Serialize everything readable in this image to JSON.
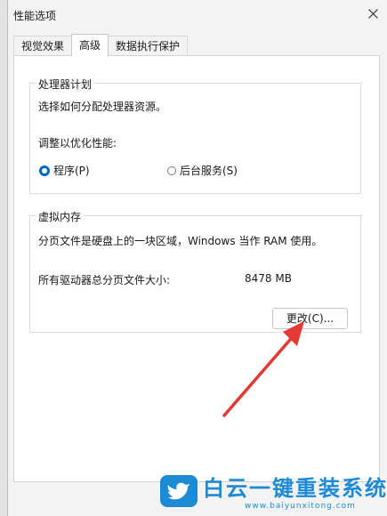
{
  "window": {
    "title": "性能选项"
  },
  "tabs": [
    {
      "label": "视觉效果"
    },
    {
      "label": "高级"
    },
    {
      "label": "数据执行保护"
    }
  ],
  "processor": {
    "title": "处理器计划",
    "description": "选择如何分配处理器资源。",
    "adjust_label": "调整以优化性能:",
    "options": [
      {
        "label": "程序(P)",
        "selected": true
      },
      {
        "label": "后台服务(S)",
        "selected": false
      }
    ]
  },
  "virtual_memory": {
    "title": "虚拟内存",
    "description": "分页文件是硬盘上的一块区域，Windows 当作 RAM 使用。",
    "total_label": "所有驱动器总分页文件大小:",
    "total_value": "8478 MB",
    "change_button": "更改(C)..."
  },
  "watermark": {
    "brand": "白云一键重装系统",
    "url": "www.baiyunxitong.com"
  },
  "colors": {
    "accent": "#0067c0",
    "arrow": "#e53935",
    "brand": "#1d8ad6"
  }
}
